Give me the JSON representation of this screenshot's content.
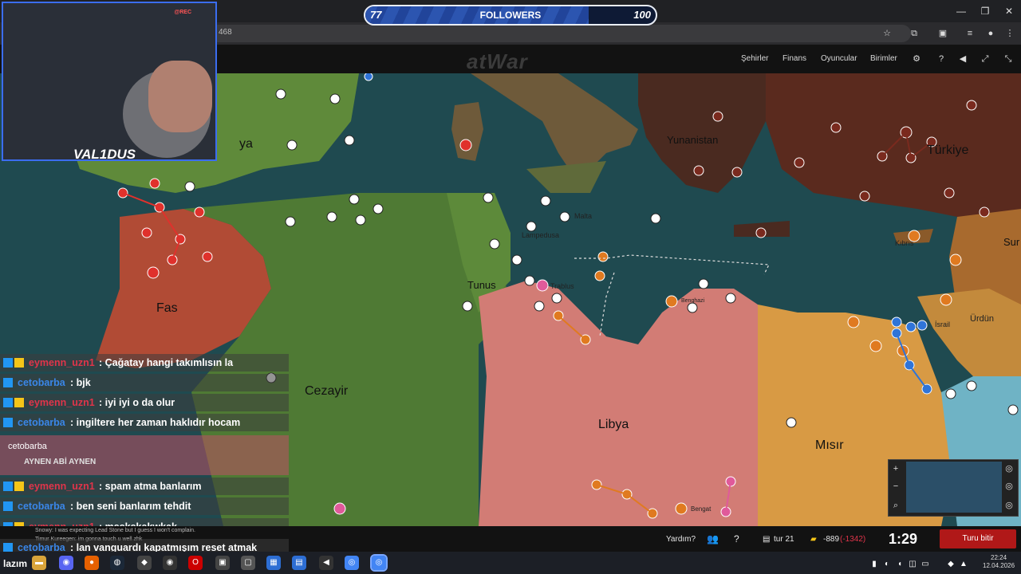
{
  "browser": {
    "url": "468",
    "window_controls": [
      "—",
      "❐",
      "✕"
    ]
  },
  "followers": {
    "current": "77",
    "label": "FOLLOWERS",
    "goal": "100",
    "progress": 0.77
  },
  "game": {
    "logo": "atWar",
    "nav": {
      "cities": "Şehirler",
      "finance": "Finans",
      "players": "Oyuncular",
      "units": "Birimler"
    },
    "help": "Yardım?",
    "turn": "tur 21",
    "gold": "-889",
    "gold_delta": "(-1342)",
    "timer": "1:29",
    "end_turn": "Turu bitir"
  },
  "map": {
    "countries": {
      "spain": "ya",
      "morocco": "Fas",
      "algeria": "Cezayir",
      "tunisia": "Tunus",
      "libya": "Libya",
      "egypt": "Mısır",
      "greece": "Yunanistan",
      "turkey": "Türkiye",
      "jordan": "Ürdün",
      "syria": "Sur"
    },
    "cities": {
      "malta": "Malta",
      "lampedusa": "Lampedusa",
      "tripoli": "Trablus",
      "benghazi": "Benghazi",
      "bengat": "Bengat",
      "israel": "İsrail",
      "kibris": "Kıbrıs"
    }
  },
  "webcam": {
    "rec": "@REC",
    "handle": "VAL1DUS"
  },
  "chat": [
    {
      "user": "eymenn_uzn1",
      "color": "red",
      "msg": ": Çağatay hangi takımlısın la"
    },
    {
      "user": "cetobarba",
      "color": "blue",
      "msg": ": bjk"
    },
    {
      "user": "eymenn_uzn1",
      "color": "red",
      "msg": ": iyi iyi o da olur"
    },
    {
      "user": "cetobarba",
      "color": "blue",
      "msg": ": ingiltere her zaman haklıdır hocam"
    },
    {
      "user": "eymenn_uzn1",
      "color": "red",
      "msg": ": spam atma banlarım"
    },
    {
      "user": "cetobarba",
      "color": "blue",
      "msg": ": ben seni banlarım tehdit"
    },
    {
      "user": "eymenn_uzn1",
      "color": "red",
      "msg": ": msskskakwkak"
    },
    {
      "user": "cetobarba",
      "color": "blue",
      "msg": ": lan vanguardı kapatmışım reset atmak"
    }
  ],
  "highlight": {
    "user": "cetobarba",
    "msg": "AYNEN ABİ AYNEN"
  },
  "ghost_chat": [
    "Snowy: I was expecting Lead Stone but I guess I won't complain.",
    "Timur Kureegen: im gonna touch u well zhk"
  ],
  "taskbar": {
    "overlay_text": "lazım",
    "time": "22:24",
    "date": "12.04.2026"
  }
}
